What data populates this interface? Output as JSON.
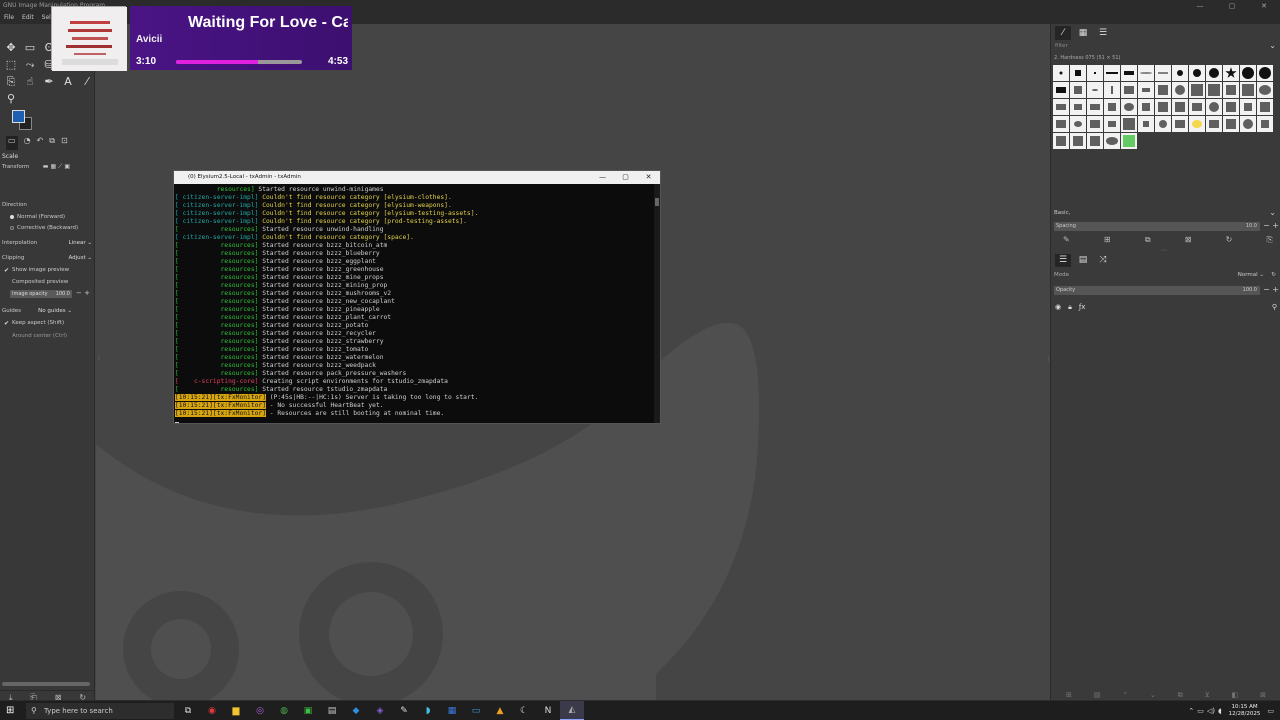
{
  "window": {
    "title": "GNU Image Manipulation Program",
    "controls": [
      "—",
      "▢",
      "✕"
    ]
  },
  "menu": [
    "File",
    "Edit",
    "Select"
  ],
  "toolbox": {
    "tool_options_title": "Scale",
    "transform_label": "Transform",
    "direction_label": "Direction",
    "direction_options": [
      "Normal (Forward)",
      "Corrective (Backward)"
    ],
    "interpolation_label": "Interpolation",
    "interpolation_value": "Linear",
    "clipping_label": "Clipping",
    "clipping_value": "Adjust",
    "show_preview": "Show image preview",
    "composited_preview": "Composited preview",
    "image_opacity_label": "Image opacity",
    "image_opacity_value": "100.0",
    "guides_label": "Guides",
    "guides_value": "No guides",
    "keep_aspect": "Keep aspect (Shift)",
    "around_center": "Around center (Ctrl)",
    "fg_color": "#1f5fb0",
    "bg_color": "#222222"
  },
  "dock": {
    "filter_placeholder": "filter",
    "brush_name": "2. Hardness 075 (51 × 51)",
    "preset": "Basic,",
    "spacing_label": "Spacing",
    "spacing_value": "10.0",
    "mode_label": "Mode",
    "mode_value": "Normal",
    "opacity_label": "Opacity",
    "opacity_value": "100.0"
  },
  "terminal": {
    "title": "(0) Elysium2.5-Local - txAdmin - txAdmin",
    "lines": [
      {
        "tag": "           resources]",
        "cls": "t-res",
        "text": " Started resource unwind-minigames",
        "tcls": "t-txt"
      },
      {
        "tag": "[ citizen-server-impl]",
        "cls": "t-cit",
        "text": " Couldn't find resource category [elysium-clothes].",
        "tcls": "t-warn"
      },
      {
        "tag": "[ citizen-server-impl]",
        "cls": "t-cit",
        "text": " Couldn't find resource category [elysium-weapons].",
        "tcls": "t-warn"
      },
      {
        "tag": "[ citizen-server-impl]",
        "cls": "t-cit",
        "text": " Couldn't find resource category [elysium-testing-assets].",
        "tcls": "t-warn"
      },
      {
        "tag": "[ citizen-server-impl]",
        "cls": "t-cit",
        "text": " Couldn't find resource category [prod-testing-assets].",
        "tcls": "t-warn"
      },
      {
        "tag": "[           resources]",
        "cls": "t-res",
        "text": " Started resource unwind-handling",
        "tcls": "t-txt"
      },
      {
        "tag": "[ citizen-server-impl]",
        "cls": "t-cit",
        "text": " Couldn't find resource category [space].",
        "tcls": "t-warn"
      },
      {
        "tag": "[           resources]",
        "cls": "t-res",
        "text": " Started resource bzzz_bitcoin_atm",
        "tcls": "t-txt"
      },
      {
        "tag": "[           resources]",
        "cls": "t-res",
        "text": " Started resource bzzz_blueberry",
        "tcls": "t-txt"
      },
      {
        "tag": "[           resources]",
        "cls": "t-res",
        "text": " Started resource bzzz_eggplant",
        "tcls": "t-txt"
      },
      {
        "tag": "[           resources]",
        "cls": "t-res",
        "text": " Started resource bzzz_greenhouse",
        "tcls": "t-txt"
      },
      {
        "tag": "[           resources]",
        "cls": "t-res",
        "text": " Started resource bzzz_mine_props",
        "tcls": "t-txt"
      },
      {
        "tag": "[           resources]",
        "cls": "t-res",
        "text": " Started resource bzzz_mining_prop",
        "tcls": "t-txt"
      },
      {
        "tag": "[           resources]",
        "cls": "t-res",
        "text": " Started resource bzzz_mushrooms_v2",
        "tcls": "t-txt"
      },
      {
        "tag": "[           resources]",
        "cls": "t-res",
        "text": " Started resource bzzz_new_cocaplant",
        "tcls": "t-txt"
      },
      {
        "tag": "[           resources]",
        "cls": "t-res",
        "text": " Started resource bzzz_pineapple",
        "tcls": "t-txt"
      },
      {
        "tag": "[           resources]",
        "cls": "t-res",
        "text": " Started resource bzzz_plant_carrot",
        "tcls": "t-txt"
      },
      {
        "tag": "[           resources]",
        "cls": "t-res",
        "text": " Started resource bzzz_potato",
        "tcls": "t-txt"
      },
      {
        "tag": "[           resources]",
        "cls": "t-res",
        "text": " Started resource bzzz_recycler",
        "tcls": "t-txt"
      },
      {
        "tag": "[           resources]",
        "cls": "t-res",
        "text": " Started resource bzzz_strawberry",
        "tcls": "t-txt"
      },
      {
        "tag": "[           resources]",
        "cls": "t-res",
        "text": " Started resource bzzz_tomato",
        "tcls": "t-txt"
      },
      {
        "tag": "[           resources]",
        "cls": "t-res",
        "text": " Started resource bzzz_watermelon",
        "tcls": "t-txt"
      },
      {
        "tag": "[           resources]",
        "cls": "t-res",
        "text": " Started resource bzzz_weedpack",
        "tcls": "t-txt"
      },
      {
        "tag": "[           resources]",
        "cls": "t-res",
        "text": " Started resource pack_pressure_washers",
        "tcls": "t-txt"
      },
      {
        "tag": "[    c-scripting-core]",
        "cls": "t-scr",
        "text": " Creating script environments for tstudio_zmapdata",
        "tcls": "t-txt"
      },
      {
        "tag": "[           resources]",
        "cls": "t-res",
        "text": " Started resource tstudio_zmapdata",
        "tcls": "t-txt"
      },
      {
        "tag": "[10:15:21][tx:FxMonitor]",
        "cls": "t-mon",
        "text": " (P:45s|HB:--|HC:1s) Server is taking too long to start.",
        "tcls": "t-txt"
      },
      {
        "tag": "[10:15:21][tx:FxMonitor]",
        "cls": "t-mon",
        "text": " - No successful HeartBeat yet.",
        "tcls": "t-txt"
      },
      {
        "tag": "[10:15:21][tx:FxMonitor]",
        "cls": "t-mon",
        "text": " - Resources are still booting at nominal time.",
        "tcls": "t-txt"
      }
    ]
  },
  "music": {
    "title": "Waiting For Love - Ca",
    "artist": "Avicii",
    "current": "3:10",
    "total": "4:53",
    "progress": 0.648,
    "accent": "#e021e0"
  },
  "taskbar": {
    "search_placeholder": "Type here to search",
    "time": "10:15 AM",
    "date": "12/28/2025",
    "apps": [
      {
        "name": "task-view-icon",
        "glyph": "⧉",
        "color": "#dddddd"
      },
      {
        "name": "app-red-icon",
        "glyph": "◉",
        "color": "#e03a3a"
      },
      {
        "name": "file-explorer-icon",
        "glyph": "▆",
        "color": "#f2c230"
      },
      {
        "name": "app-purple-icon",
        "glyph": "◎",
        "color": "#b060e0"
      },
      {
        "name": "chrome-icon",
        "glyph": "◍",
        "color": "#4caf50"
      },
      {
        "name": "app-green-icon",
        "glyph": "▣",
        "color": "#3fbf3f"
      },
      {
        "name": "notepad-icon",
        "glyph": "▤",
        "color": "#cccccc"
      },
      {
        "name": "vscode-icon",
        "glyph": "◆",
        "color": "#2f8fe0"
      },
      {
        "name": "visual-studio-icon",
        "glyph": "◈",
        "color": "#8a5bd6"
      },
      {
        "name": "app-dark-icon",
        "glyph": "✎",
        "color": "#dddddd"
      },
      {
        "name": "app-teal-icon",
        "glyph": "◗",
        "color": "#40c0e0"
      },
      {
        "name": "app-blue-icon",
        "glyph": "▦",
        "color": "#3a7be0"
      },
      {
        "name": "app-monitor-icon",
        "glyph": "▭",
        "color": "#3aa0e0"
      },
      {
        "name": "app-orange-icon",
        "glyph": "▲",
        "color": "#f0a020"
      },
      {
        "name": "app-c-icon",
        "glyph": "☾",
        "color": "#dddddd"
      },
      {
        "name": "app-n-icon",
        "glyph": "N",
        "color": "#dddddd"
      },
      {
        "name": "gimp-icon",
        "glyph": "◭",
        "color": "#aaaaaa",
        "active": true
      }
    ]
  }
}
